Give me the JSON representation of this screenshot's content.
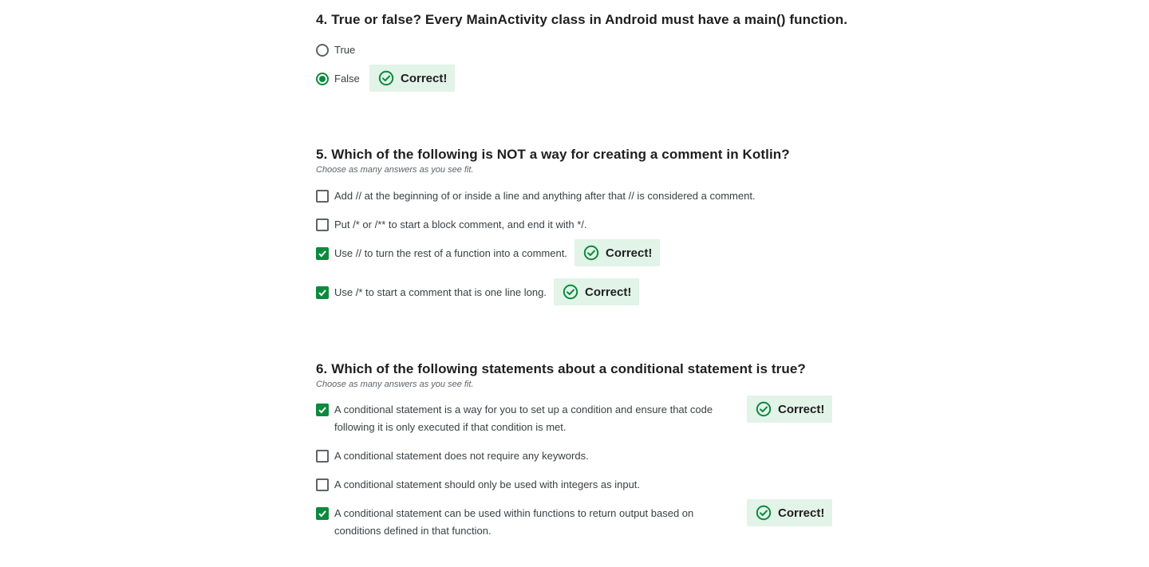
{
  "questions": [
    {
      "title": "4. True or false? Every MainActivity class in Android must have a main() function.",
      "hint": "",
      "options": [
        {
          "label": "True",
          "selected": false,
          "feedback": ""
        },
        {
          "label": "False",
          "selected": true,
          "feedback": "Correct!"
        }
      ]
    },
    {
      "title": "5. Which of the following is NOT a way for creating a comment in Kotlin?",
      "hint": "Choose as many answers as you see fit.",
      "options": [
        {
          "label": "Add // at the beginning of or inside a line and anything after that // is considered a comment.",
          "selected": false,
          "feedback": ""
        },
        {
          "label": "Put /* or /** to start a block comment, and end it with */.",
          "selected": false,
          "feedback": ""
        },
        {
          "label": "Use // to turn the rest of a function into a comment.",
          "selected": true,
          "feedback": "Correct!"
        },
        {
          "label": "Use /* to start a comment that is one line long.",
          "selected": true,
          "feedback": "Correct!"
        }
      ]
    },
    {
      "title": "6. Which of the following statements about a conditional statement is true?",
      "hint": "Choose as many answers as you see fit.",
      "options": [
        {
          "label": "A conditional statement is a way for you to set up a condition and ensure that code following it is only executed if that condition is met.",
          "selected": true,
          "feedback": "Correct!"
        },
        {
          "label": "A conditional statement does not require any keywords.",
          "selected": false,
          "feedback": ""
        },
        {
          "label": "A conditional statement should only be used with integers as input.",
          "selected": false,
          "feedback": ""
        },
        {
          "label": "A conditional statement can be used within functions to return output based on conditions defined in that function.",
          "selected": true,
          "feedback": "Correct!"
        }
      ]
    }
  ],
  "colors": {
    "accent": "#0b8a3e",
    "feedback_bg": "#e2f3e8"
  },
  "icons": {
    "feedback": "check-circle-icon",
    "checkbox_checked": "checkmark-icon"
  }
}
